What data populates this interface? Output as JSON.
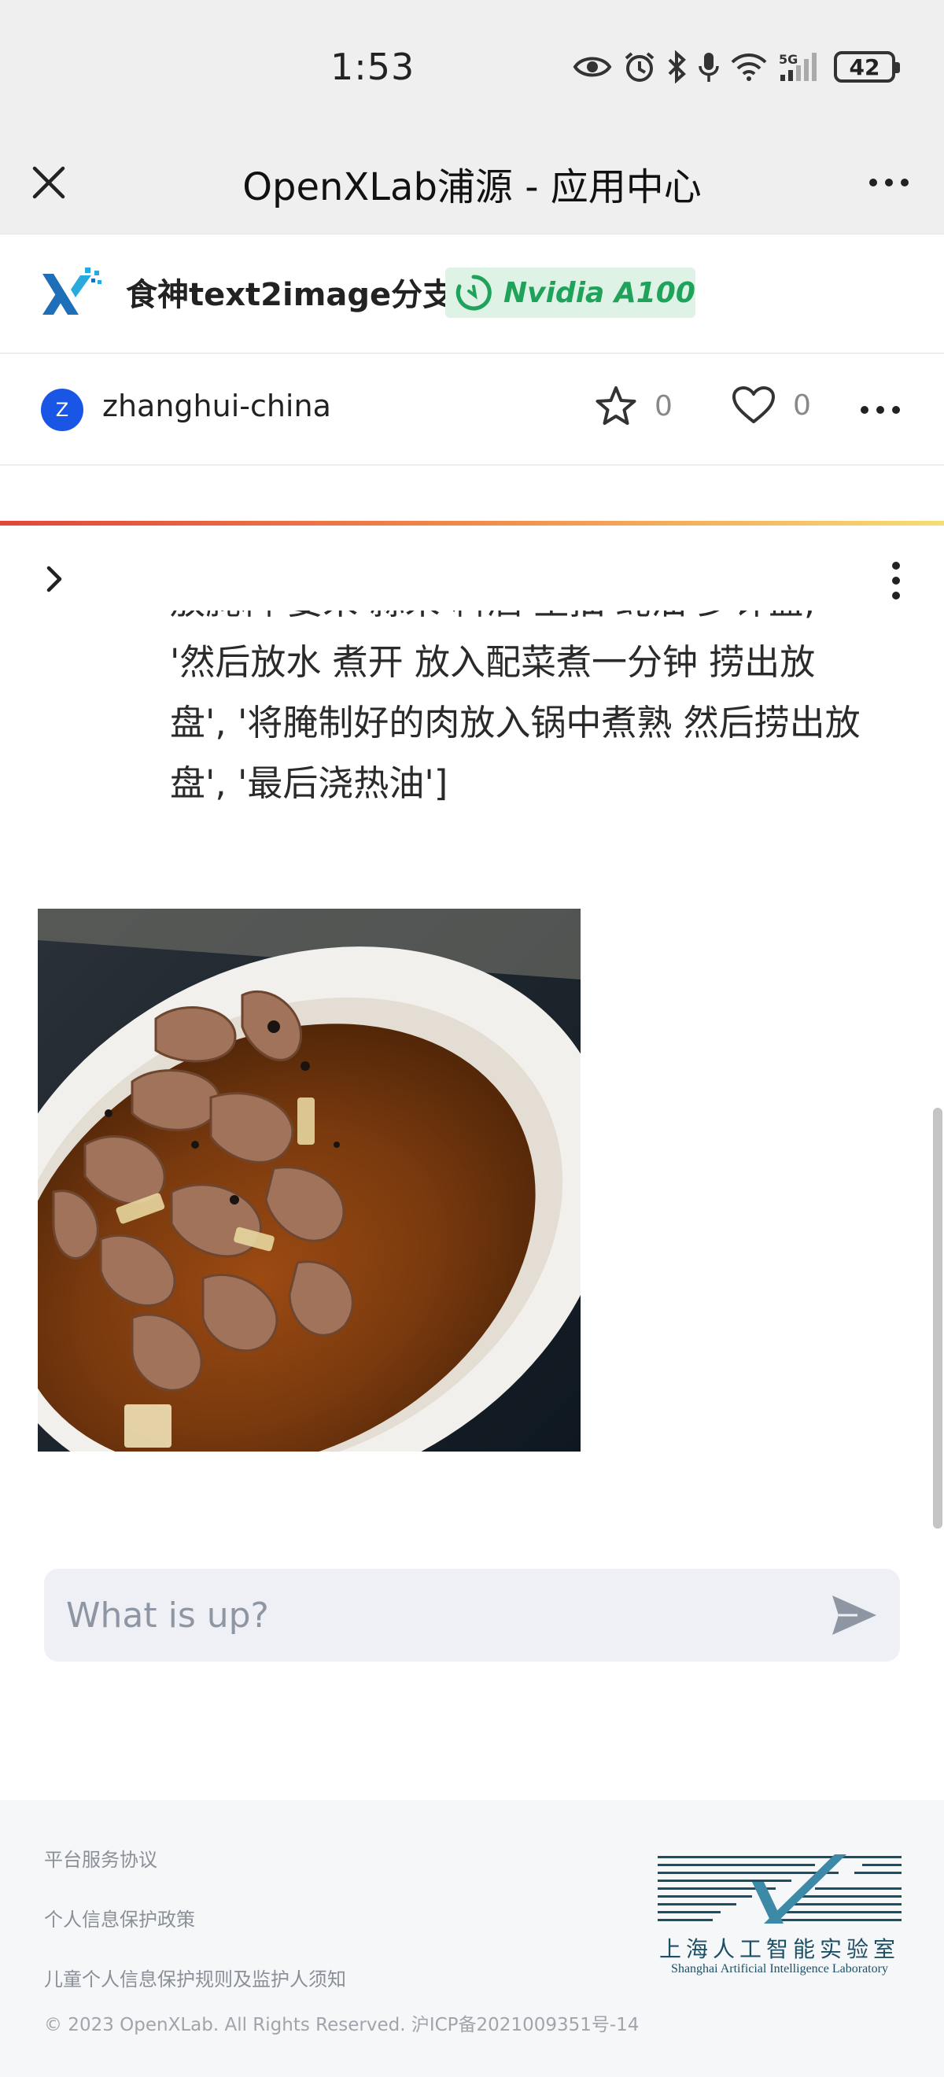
{
  "status_bar": {
    "time": "1:53",
    "battery": "42",
    "network": "5G"
  },
  "app_bar": {
    "title": "OpenXLab浦源 - 应用中心"
  },
  "project": {
    "title": "食神text2image分支",
    "gpu_label": "Nvidia A100"
  },
  "author": {
    "avatar_letter": "Z",
    "name": "zhanghui-china",
    "star_count": "0",
    "like_count": "0"
  },
  "message": {
    "text": "...'然后放水 煮开 放入配菜煮一分钟 捞出放盘', '将腌制好的肉放入锅中煮熟 然后捞出放盘', '最后浇热油']",
    "lines": [
      "放腌料 姜末 蒜末 料酒 生抽 蚝油 少许盐,",
      "'然后放水 煮开 放入配菜煮一分钟 捞出放",
      "盘', '将腌制好的肉放入锅中煮熟 然后捞出放",
      "盘', '最后浇热油']"
    ]
  },
  "chat": {
    "placeholder": "What is up?"
  },
  "footer": {
    "links": [
      "平台服务协议",
      "个人信息保护政策",
      "儿童个人信息保护规则及监护人须知"
    ],
    "copyright": "© 2023 OpenXLab. All Rights Reserved. 沪ICP备2021009351号-14",
    "lab_name_cn": "上海人工智能实验室",
    "lab_name_en": "Shanghai Artificial Intelligence Laboratory"
  },
  "colors": {
    "accent_green": "#1fa35b",
    "avatar_blue": "#1a56e6",
    "lab_teal": "#1d4f64"
  }
}
